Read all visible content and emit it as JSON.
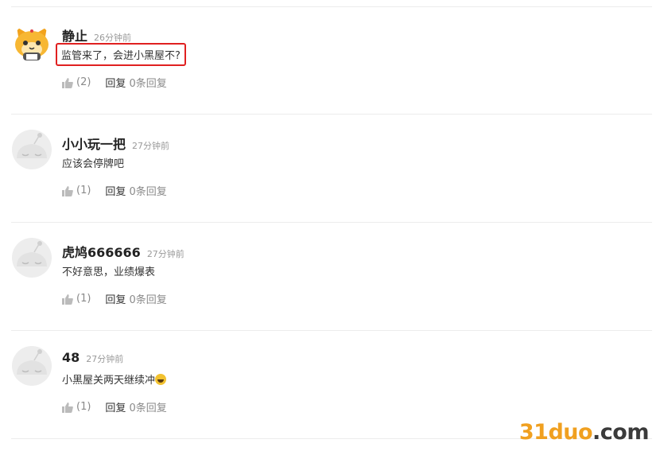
{
  "comments": [
    {
      "author": "静止",
      "time": "26分钟前",
      "text": "监管来了，会进小黑屋不?",
      "likes": "(2)",
      "reply_label": "回复",
      "replies": "0条回复",
      "avatar_icon": "cat-avatar-icon",
      "highlighted": true
    },
    {
      "author": "小小玩一把",
      "time": "27分钟前",
      "text": "应该会停牌吧",
      "likes": "(1)",
      "reply_label": "回复",
      "replies": "0条回复",
      "avatar_icon": "default-avatar-icon"
    },
    {
      "author": "虎鸠666666",
      "time": "27分钟前",
      "text": "不好意思，业绩爆表",
      "likes": "(1)",
      "reply_label": "回复",
      "replies": "0条回复",
      "avatar_icon": "default-avatar-icon"
    },
    {
      "author": "48",
      "time": "27分钟前",
      "text": "小黑屋关两天继续冲",
      "likes": "(1)",
      "reply_label": "回复",
      "replies": "0条回复",
      "avatar_icon": "default-avatar-icon",
      "emoji_icon": "grinning-face-icon"
    }
  ],
  "watermark": {
    "part1": "31duo",
    "part2": ".com"
  },
  "colors": {
    "highlight": "#e02020",
    "watermark_orange": "#f0a020"
  }
}
